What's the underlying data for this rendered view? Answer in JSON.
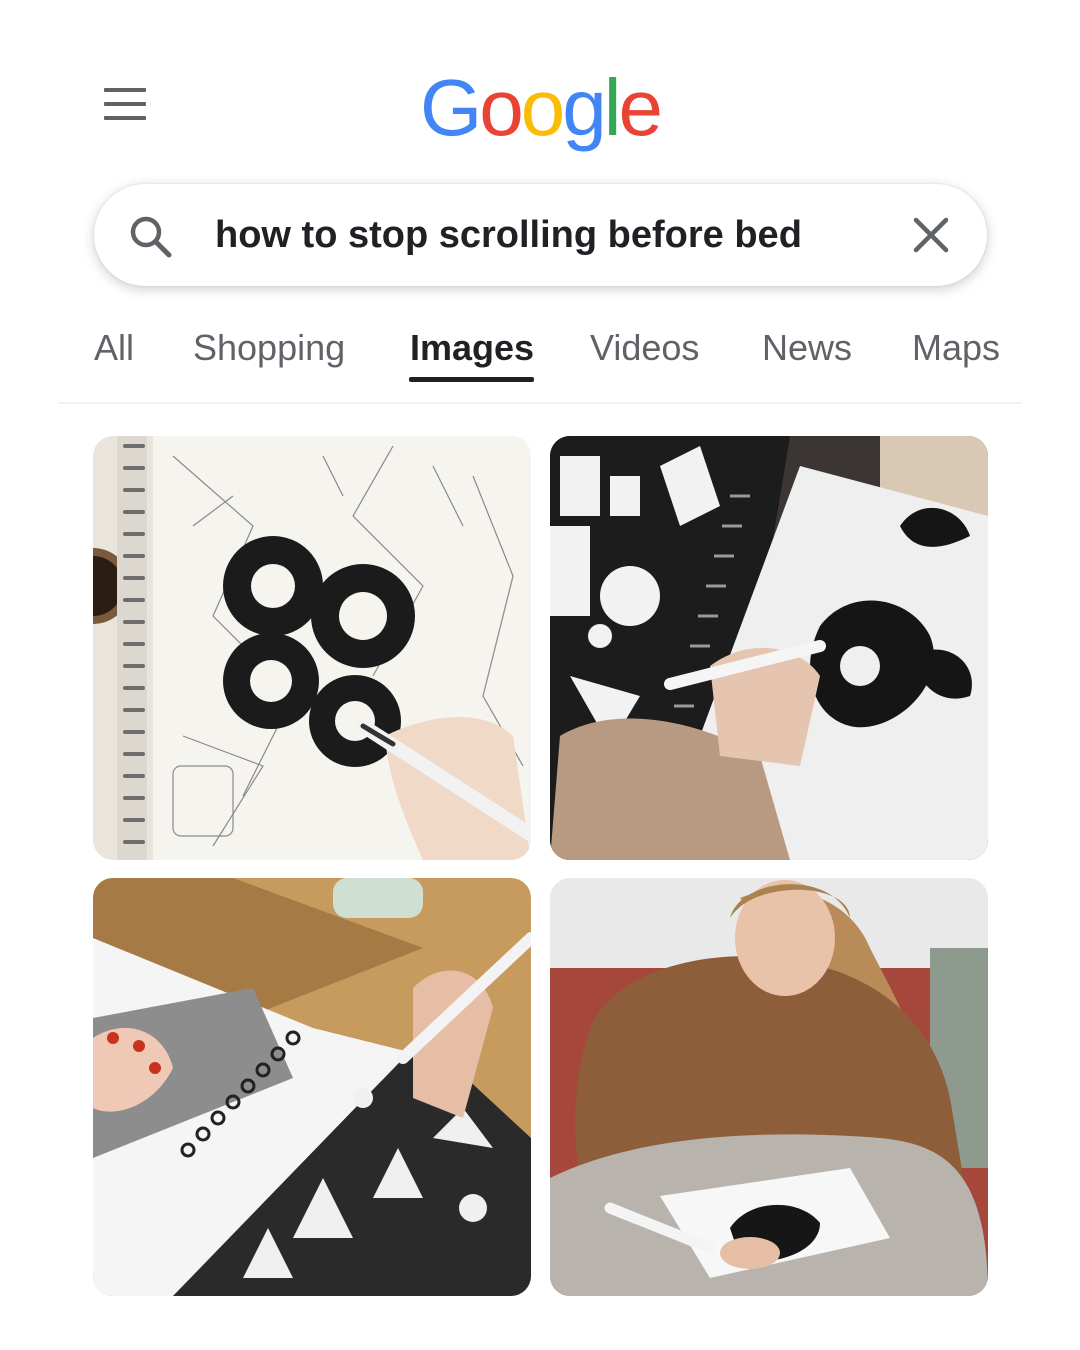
{
  "header": {
    "logo_letters": [
      "G",
      "o",
      "o",
      "g",
      "l",
      "e"
    ],
    "logo_colors": [
      "#4285F4",
      "#EA4335",
      "#FBBC05",
      "#4285F4",
      "#34A853",
      "#EA4335"
    ],
    "menu_icon": "hamburger-menu-icon"
  },
  "search": {
    "query": "how to stop scrolling before bed",
    "search_icon": "search-icon",
    "clear_icon": "close-icon"
  },
  "tabs": [
    {
      "label": "All",
      "active": false
    },
    {
      "label": "Shopping",
      "active": false
    },
    {
      "label": "Images",
      "active": true
    },
    {
      "label": "Videos",
      "active": false
    },
    {
      "label": "News",
      "active": false
    },
    {
      "label": "Maps",
      "active": false
    }
  ],
  "colors": {
    "text_primary": "#202124",
    "text_secondary": "#5f6368"
  }
}
